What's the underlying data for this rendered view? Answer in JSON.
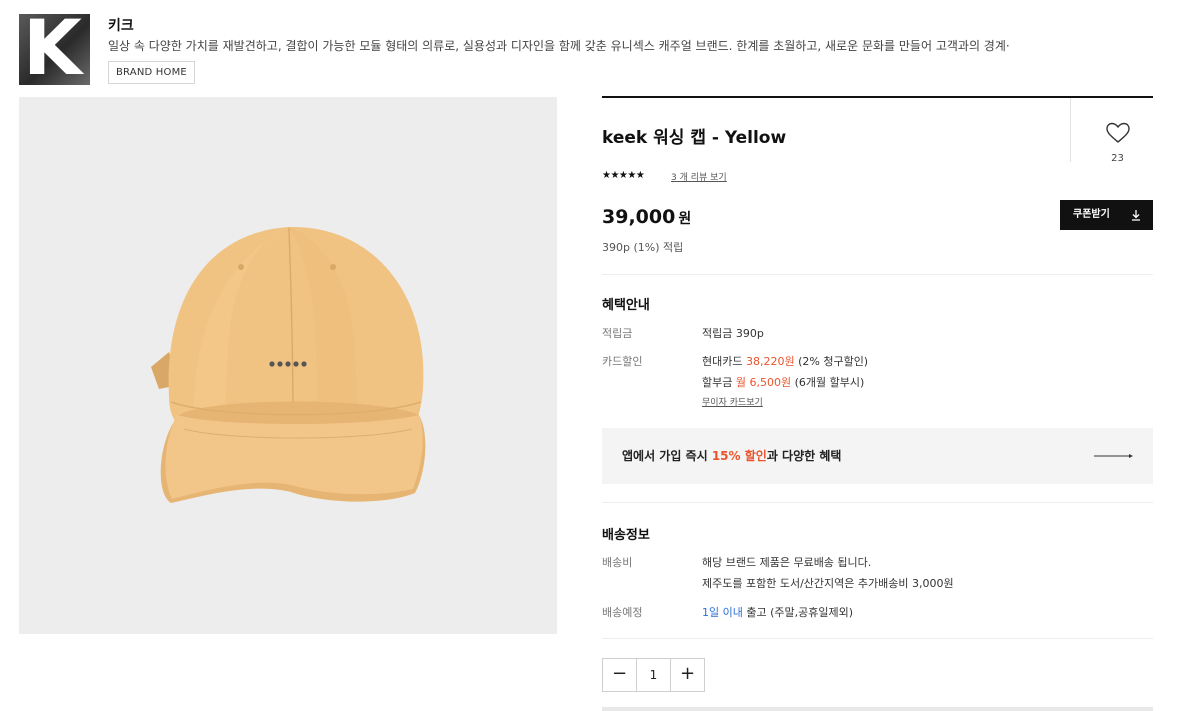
{
  "brand": {
    "logo_letter": "K",
    "name": "키크",
    "description": "일상 속 다양한 가치를 재발견하고, 결합이 가능한 모듈 형태의 의류로, 실용성과 디자인을 함께 갖춘 유니섹스 캐주얼 브랜드. 한계를 초월하고, 새로운 문화를 만들어 고객과의 경계·",
    "home_button": "BRAND HOME"
  },
  "product": {
    "title": "keek 워싱 캡 - Yellow",
    "like_count": "23",
    "rating_stars": "★★★★★",
    "review_link": "3 개 리뷰 보기",
    "price": "39,000",
    "price_unit": "원",
    "points": "390p (1%) 적립",
    "coupon_button": "쿠폰받기",
    "image_color": "#f1c384"
  },
  "benefits": {
    "title": "혜택안내",
    "points_label": "적립금",
    "points_value": "적립금 390p",
    "card_label": "카드할인",
    "card_line1_prefix": "현대카드 ",
    "card_line1_amount": "38,220원",
    "card_line1_suffix": " (2% 청구할인)",
    "card_line2_prefix": "할부금 ",
    "card_line2_amount": "월 6,500원",
    "card_line2_suffix": " (6개월 할부시)",
    "card_link": "무이자 카드보기"
  },
  "app_banner": {
    "prefix": "앱에서 가입 즉시 ",
    "highlight_pct": "15%",
    "highlight_word": " 할인",
    "suffix": "과 다양한 혜택"
  },
  "shipping": {
    "title": "배송정보",
    "fee_label": "배송비",
    "fee_line1": "해당 브랜드 제품은 무료배송 됩니다.",
    "fee_line2": "제주도를 포함한 도서/산간지역은 추가배송비 3,000원",
    "eta_label": "배송예정",
    "eta_highlight": "1일 이내",
    "eta_rest": " 출고 (주말,공휴일제외)"
  },
  "quantity": {
    "minus": "−",
    "value": "1",
    "plus": "+"
  },
  "colors": {
    "accent_red": "#e8552e",
    "accent_blue": "#2b6fd6",
    "coupon_bg": "#111111"
  }
}
